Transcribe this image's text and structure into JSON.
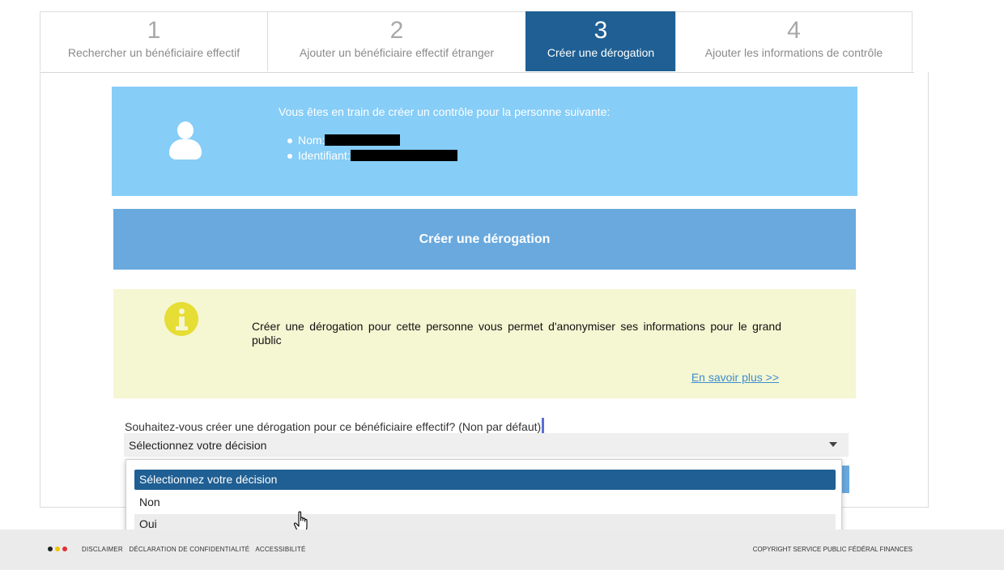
{
  "steps": [
    {
      "number": "1",
      "label": "Rechercher un bénéficiaire effectif"
    },
    {
      "number": "2",
      "label": "Ajouter un bénéficiaire effectif étranger"
    },
    {
      "number": "3",
      "label": "Créer une dérogation"
    },
    {
      "number": "4",
      "label": "Ajouter les informations de contrôle"
    }
  ],
  "active_step": 3,
  "person": {
    "intro": "Vous êtes en train de créer un contrôle pour la personne suivante:",
    "name_label": "Nom:",
    "id_label": "Identifiant:"
  },
  "section_title": "Créer une dérogation",
  "info": {
    "text": "Créer une dérogation pour cette personne vous permet d'anonymiser ses informations pour le grand public",
    "link": "En savoir plus >>"
  },
  "question": "Souhaitez-vous créer une dérogation pour ce bénéficiaire effectif? (Non par défaut)",
  "select": {
    "value": "Sélectionnez votre décision",
    "options": [
      "Sélectionnez votre décision",
      "Non",
      "Oui"
    ]
  },
  "footer": {
    "links": [
      "DISCLAIMER",
      "DÉCLARATION DE CONFIDENTIALITÉ",
      "ACCESSIBILITÉ"
    ],
    "copyright": "COPYRIGHT SERVICE PUBLIC FÉDÉRAL FINANCES",
    "dot_colors": [
      "#222222",
      "#f2c500",
      "#e23030"
    ]
  },
  "colors": {
    "active_step": "#1f5f93",
    "person_box": "#86cdf7",
    "section_header": "#69a9de",
    "info_box": "#f5f6d2",
    "info_icon": "#e6dd35",
    "link": "#3c8fcf"
  }
}
